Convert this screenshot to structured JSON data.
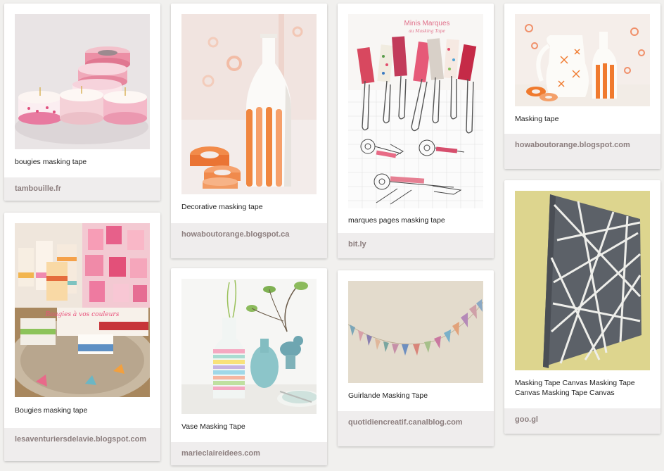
{
  "pins": [
    {
      "description": "bougies masking tape",
      "source": "tambouille.fr",
      "image": "candles-masking-tape-photo"
    },
    {
      "description": "Bougies masking tape",
      "source": "lesaventuriersdelavie.blogspot.com",
      "image": "bougies-vos-couleurs-photo",
      "overlay_text": "Bougies à vos couleurs"
    },
    {
      "description": "Decorative masking tape",
      "source": "howaboutorange.blogspot.ca",
      "image": "white-bottle-orange-tape-photo"
    },
    {
      "description": "Vase Masking Tape",
      "source": "marieclaireidees.com",
      "image": "striped-vases-photo"
    },
    {
      "description": "marques pages masking tape",
      "source": "bit.ly",
      "image": "paperclip-bookmarks-photo",
      "overlay_title": "Minis Marques",
      "overlay_subtitle": "au Masking Tape"
    },
    {
      "description": "Guirlande Masking Tape",
      "source": "quotidiencreatif.canalblog.com",
      "image": "flag-garland-photo"
    },
    {
      "description": "Masking tape",
      "source": "howaboutorange.blogspot.com",
      "image": "vases-orange-tape-photo"
    },
    {
      "description": "Masking Tape Canvas Masking Tape Canvas Masking Tape Canvas",
      "source": "goo.gl",
      "image": "gray-canvas-tape-art-photo"
    }
  ],
  "colors": {
    "background": "#f1f0ee",
    "source_bar": "#efeded",
    "source_text": "#8c7e7e",
    "accent_orange": "#f07a2e"
  }
}
